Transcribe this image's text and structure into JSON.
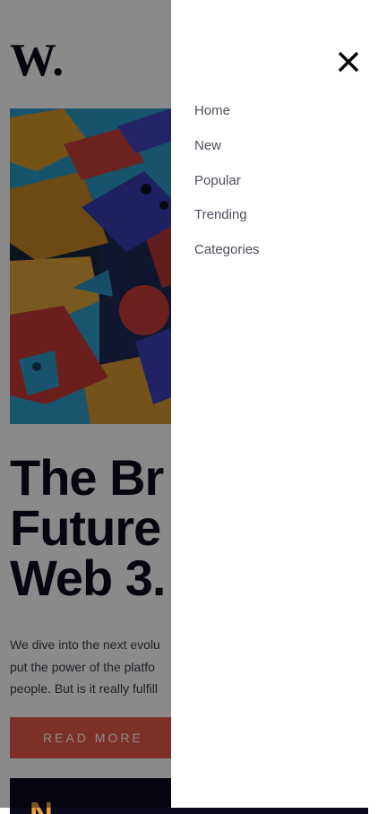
{
  "header": {
    "logo_text": "W."
  },
  "article": {
    "headline": "The Br\nFuture\nWeb 3.",
    "excerpt": "We dive into the next evolu\nput the power of the platfo\npeople. But is it really fulfill",
    "read_more_label": "READ MORE"
  },
  "next_card": {
    "letter": "N"
  },
  "drawer": {
    "nav_items": [
      {
        "label": "Home"
      },
      {
        "label": "New"
      },
      {
        "label": "Popular"
      },
      {
        "label": "Trending"
      },
      {
        "label": "Categories"
      }
    ]
  },
  "colors": {
    "accent": "#e85a45",
    "dark": "#0c0b1d",
    "overlay": "rgba(0,0,0,0.46)"
  },
  "icons": {
    "close": "close-icon",
    "logo": "logo-icon"
  }
}
